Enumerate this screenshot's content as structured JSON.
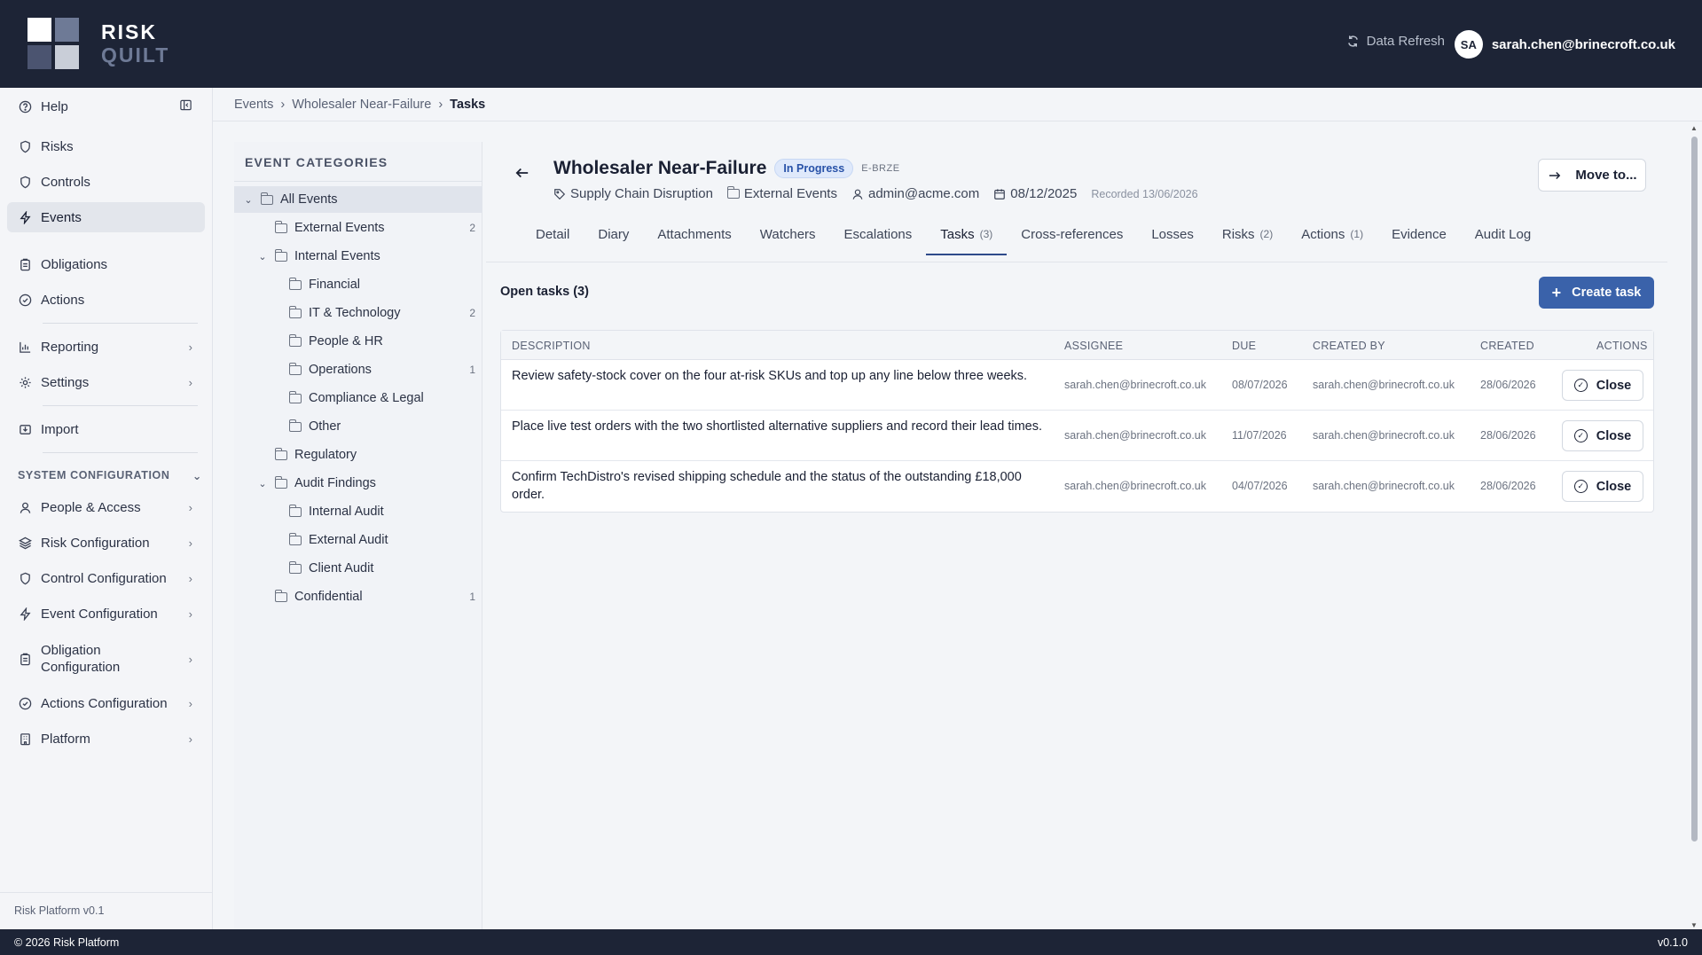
{
  "brand": {
    "line1": "RISK",
    "line2": "QUILT"
  },
  "header": {
    "refresh_label": "Data Refresh",
    "avatar_initials": "SA",
    "user_email": "sarah.chen@brinecroft.co.uk"
  },
  "sidebar": {
    "help": "Help",
    "items": {
      "risks": "Risks",
      "controls": "Controls",
      "events": "Events",
      "obligations": "Obligations",
      "actions": "Actions",
      "reporting": "Reporting",
      "settings": "Settings",
      "import": "Import"
    },
    "system_heading": "SYSTEM CONFIGURATION",
    "system_items": {
      "people": "People & Access",
      "risk_config": "Risk Configuration",
      "control_config": "Control Configuration",
      "event_config": "Event Configuration",
      "obligation_config_1": "Obligation",
      "obligation_config_2": "Configuration",
      "actions_config": "Actions Configuration",
      "platform": "Platform"
    },
    "footer": "Risk Platform v0.1"
  },
  "breadcrumb": {
    "b1": "Events",
    "b2": "Wholesaler Near-Failure",
    "b3": "Tasks"
  },
  "categories": {
    "title": "EVENT CATEGORIES",
    "all": "All Events",
    "external": "External Events",
    "external_count": "2",
    "internal": "Internal Events",
    "financial": "Financial",
    "it": "IT & Technology",
    "it_count": "2",
    "people": "People & HR",
    "operations": "Operations",
    "operations_count": "1",
    "compliance": "Compliance & Legal",
    "other": "Other",
    "regulatory": "Regulatory",
    "audit": "Audit Findings",
    "internal_audit": "Internal Audit",
    "external_audit": "External Audit",
    "client_audit": "Client Audit",
    "confidential": "Confidential",
    "confidential_count": "1"
  },
  "event": {
    "title": "Wholesaler Near-Failure",
    "status": "In Progress",
    "code": "E-BRZE",
    "category": "Supply Chain Disruption",
    "folder": "External Events",
    "owner": "admin@acme.com",
    "date": "08/12/2025",
    "recorded": "Recorded 13/06/2026",
    "move_label": "Move to..."
  },
  "tabs": {
    "detail": "Detail",
    "diary": "Diary",
    "attachments": "Attachments",
    "watchers": "Watchers",
    "escalations": "Escalations",
    "tasks": "Tasks",
    "tasks_count": "(3)",
    "xref": "Cross-references",
    "losses": "Losses",
    "risks": "Risks",
    "risks_count": "(2)",
    "actions": "Actions",
    "actions_count": "(1)",
    "evidence": "Evidence",
    "audit": "Audit Log"
  },
  "tasks": {
    "open_label": "Open tasks (3)",
    "create_label": "Create task",
    "headers": {
      "description": "DESCRIPTION",
      "assignee": "ASSIGNEE",
      "due": "DUE",
      "created_by": "CREATED BY",
      "created": "CREATED",
      "actions": "ACTIONS"
    },
    "rows": [
      {
        "description": "Review safety-stock cover on the four at-risk SKUs and top up any line below three weeks.",
        "assignee": "sarah.chen@brinecroft.co.uk",
        "due": "08/07/2026",
        "created_by": "sarah.chen@brinecroft.co.uk",
        "created": "28/06/2026",
        "action": "Close"
      },
      {
        "description": "Place live test orders with the two shortlisted alternative suppliers and record their lead times.",
        "assignee": "sarah.chen@brinecroft.co.uk",
        "due": "11/07/2026",
        "created_by": "sarah.chen@brinecroft.co.uk",
        "created": "28/06/2026",
        "action": "Close"
      },
      {
        "description": "Confirm TechDistro's revised shipping schedule and the status of the outstanding £18,000 order.",
        "assignee": "sarah.chen@brinecroft.co.uk",
        "due": "04/07/2026",
        "created_by": "sarah.chen@brinecroft.co.uk",
        "created": "28/06/2026",
        "action": "Close"
      }
    ]
  },
  "footer": {
    "copyright": "© 2026 Risk Platform",
    "version": "v0.1.0"
  },
  "colors": {
    "header_bg": "#1d2436",
    "accent": "#3a62aa",
    "status_badge": "#dfe9fb"
  }
}
